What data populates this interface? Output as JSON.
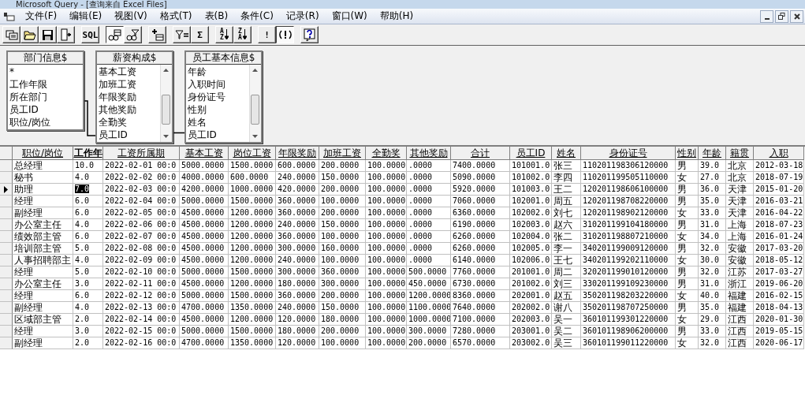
{
  "window": {
    "title": "Microsoft Query - [查询来自 Excel Files]"
  },
  "menu": [
    "文件(F)",
    "编辑(E)",
    "视图(V)",
    "格式(T)",
    "表(B)",
    "条件(C)",
    "记录(R)",
    "窗口(W)",
    "帮助(H)"
  ],
  "toolbar": [
    [
      {
        "kind": "new-query",
        "pressed": false
      },
      {
        "kind": "open",
        "pressed": false
      },
      {
        "kind": "save",
        "pressed": false
      },
      {
        "kind": "return",
        "pressed": false
      }
    ],
    [
      {
        "kind": "text",
        "label": "SQL",
        "pressed": false
      }
    ],
    [
      {
        "kind": "show-tables",
        "pressed": true
      },
      {
        "kind": "show-criteria",
        "pressed": false
      }
    ],
    [
      {
        "kind": "add-tables",
        "pressed": false
      }
    ],
    [
      {
        "kind": "criteria-equals",
        "pressed": false
      },
      {
        "kind": "text",
        "label": "Σ",
        "pressed": false
      }
    ],
    [
      {
        "kind": "sort",
        "letters": [
          "A",
          "Z"
        ],
        "pressed": false
      },
      {
        "kind": "sort",
        "letters": [
          "Z",
          "A"
        ],
        "pressed": false
      }
    ],
    [
      {
        "kind": "text",
        "label": "!",
        "pressed": false
      },
      {
        "kind": "auto-query",
        "pressed": true
      }
    ],
    [
      {
        "kind": "help",
        "pressed": false
      }
    ]
  ],
  "tables": [
    {
      "title": "部门信息$",
      "scrollbar": false,
      "fields": [
        "*",
        "工作年限",
        "所在部门",
        "员工ID",
        "职位/岗位"
      ]
    },
    {
      "title": "薪资构成$",
      "scrollbar": true,
      "fields": [
        "基本工资",
        "加班工资",
        "年限奖励",
        "其他奖励",
        "全勤奖",
        "员工ID"
      ]
    },
    {
      "title": "员工基本信息$",
      "scrollbar": true,
      "fields": [
        "年龄",
        "入职时间",
        "身份证号",
        "性别",
        "姓名",
        "员工ID"
      ]
    }
  ],
  "grid": {
    "columns": [
      {
        "label": "职位/岗位",
        "active": false
      },
      {
        "label": "工作年",
        "active": true
      },
      {
        "label": "工资所属期",
        "active": false
      },
      {
        "label": "基本工资",
        "active": false
      },
      {
        "label": "岗位工资",
        "active": false
      },
      {
        "label": "年限奖励",
        "active": false
      },
      {
        "label": "加班工资",
        "active": false
      },
      {
        "label": "全勤奖",
        "active": false
      },
      {
        "label": "其他奖励",
        "active": false
      },
      {
        "label": "合计",
        "active": false
      },
      {
        "label": "员工ID",
        "active": false
      },
      {
        "label": "姓名",
        "active": false
      },
      {
        "label": "身份证号",
        "active": false
      },
      {
        "label": "性别",
        "active": false
      },
      {
        "label": "年龄",
        "active": false
      },
      {
        "label": "籍贯",
        "active": false
      },
      {
        "label": "入职",
        "active": false
      }
    ],
    "rows": [
      {
        "selected": false,
        "cells": [
          "总经理",
          "10.0",
          "2022-02-01 00:0",
          "5000.0000",
          "1500.0000",
          "600.0000",
          "200.0000",
          "100.0000",
          ".0000",
          "7400.0000",
          "101001.0",
          "张三",
          "110201198306120000",
          "男",
          "39.0",
          "北京",
          "2012-03-18"
        ]
      },
      {
        "selected": false,
        "cells": [
          "秘书",
          "4.0",
          "2022-02-02 00:0",
          "4000.0000",
          "600.0000",
          "240.0000",
          "150.0000",
          "100.0000",
          ".0000",
          "5090.0000",
          "101002.0",
          "李四",
          "110201199505110000",
          "女",
          "27.0",
          "北京",
          "2018-07-19"
        ]
      },
      {
        "selected": true,
        "cells": [
          "助理",
          "7.0",
          "2022-02-03 00:0",
          "4200.0000",
          "1000.0000",
          "420.0000",
          "200.0000",
          "100.0000",
          ".0000",
          "5920.0000",
          "101003.0",
          "王二",
          "120201198606100000",
          "男",
          "36.0",
          "天津",
          "2015-01-20"
        ]
      },
      {
        "selected": false,
        "cells": [
          "经理",
          "6.0",
          "2022-02-04 00:0",
          "5000.0000",
          "1500.0000",
          "360.0000",
          "100.0000",
          "100.0000",
          ".0000",
          "7060.0000",
          "102001.0",
          "周五",
          "120201198708220000",
          "男",
          "35.0",
          "天津",
          "2016-03-21"
        ]
      },
      {
        "selected": false,
        "cells": [
          "副经理",
          "6.0",
          "2022-02-05 00:0",
          "4500.0000",
          "1200.0000",
          "360.0000",
          "200.0000",
          "100.0000",
          ".0000",
          "6360.0000",
          "102002.0",
          "刘七",
          "120201198902120000",
          "女",
          "33.0",
          "天津",
          "2016-04-22"
        ]
      },
      {
        "selected": false,
        "cells": [
          "办公室主任",
          "4.0",
          "2022-02-06 00:0",
          "4500.0000",
          "1200.0000",
          "240.0000",
          "150.0000",
          "100.0000",
          ".0000",
          "6190.0000",
          "102003.0",
          "赵六",
          "310201199104180000",
          "男",
          "31.0",
          "上海",
          "2018-07-23"
        ]
      },
      {
        "selected": false,
        "cells": [
          "绩效部主管",
          "6.0",
          "2022-02-07 00:0",
          "4500.0000",
          "1200.0000",
          "360.0000",
          "100.0000",
          "100.0000",
          ".0000",
          "6260.0000",
          "102004.0",
          "张二",
          "310201198807210000",
          "女",
          "34.0",
          "上海",
          "2016-01-24"
        ]
      },
      {
        "selected": false,
        "cells": [
          "培训部主管",
          "5.0",
          "2022-02-08 00:0",
          "4500.0000",
          "1200.0000",
          "300.0000",
          "160.0000",
          "100.0000",
          ".0000",
          "6260.0000",
          "102005.0",
          "李一",
          "340201199009120000",
          "男",
          "32.0",
          "安徽",
          "2017-03-20"
        ]
      },
      {
        "selected": false,
        "cells": [
          "人事招聘部主",
          "4.0",
          "2022-02-09 00:0",
          "4500.0000",
          "1200.0000",
          "240.0000",
          "100.0000",
          "100.0000",
          ".0000",
          "6140.0000",
          "102006.0",
          "王七",
          "340201199202110000",
          "女",
          "30.0",
          "安徽",
          "2018-05-12"
        ]
      },
      {
        "selected": false,
        "cells": [
          "经理",
          "5.0",
          "2022-02-10 00:0",
          "5000.0000",
          "1500.0000",
          "300.0000",
          "360.0000",
          "100.0000",
          "500.0000",
          "7760.0000",
          "201001.0",
          "周二",
          "320201199010120000",
          "男",
          "32.0",
          "江苏",
          "2017-03-27"
        ]
      },
      {
        "selected": false,
        "cells": [
          "办公室主任",
          "3.0",
          "2022-02-11 00:0",
          "4500.0000",
          "1200.0000",
          "180.0000",
          "300.0000",
          "100.0000",
          "450.0000",
          "6730.0000",
          "201002.0",
          "刘三",
          "330201199109230000",
          "男",
          "31.0",
          "浙江",
          "2019-06-20"
        ]
      },
      {
        "selected": false,
        "cells": [
          "经理",
          "6.0",
          "2022-02-12 00:0",
          "5000.0000",
          "1500.0000",
          "360.0000",
          "200.0000",
          "100.0000",
          "1200.0000",
          "8360.0000",
          "202001.0",
          "赵五",
          "350201198203220000",
          "女",
          "40.0",
          "福建",
          "2016-02-15"
        ]
      },
      {
        "selected": false,
        "cells": [
          "副经理",
          "4.0",
          "2022-02-13 00:0",
          "4700.0000",
          "1350.0000",
          "240.0000",
          "150.0000",
          "100.0000",
          "1100.0000",
          "7640.0000",
          "202002.0",
          "谢八",
          "350201198707250000",
          "男",
          "35.0",
          "福建",
          "2018-04-13"
        ]
      },
      {
        "selected": false,
        "cells": [
          "区域部主管",
          "2.0",
          "2022-02-14 00:0",
          "4500.0000",
          "1200.0000",
          "120.0000",
          "180.0000",
          "100.0000",
          "1000.0000",
          "7100.0000",
          "202003.0",
          "吴一",
          "360101199301220000",
          "女",
          "29.0",
          "江西",
          "2020-01-30"
        ]
      },
      {
        "selected": false,
        "cells": [
          "经理",
          "3.0",
          "2022-02-15 00:0",
          "5000.0000",
          "1500.0000",
          "180.0000",
          "200.0000",
          "100.0000",
          "300.0000",
          "7280.0000",
          "203001.0",
          "吴二",
          "360101198906200000",
          "男",
          "33.0",
          "江西",
          "2019-05-15"
        ]
      },
      {
        "selected": false,
        "cells": [
          "副经理",
          "2.0",
          "2022-02-16 00:0",
          "4700.0000",
          "1350.0000",
          "120.0000",
          "100.0000",
          "100.0000",
          "200.0000",
          "6570.0000",
          "203002.0",
          "吴三",
          "360101199011220000",
          "女",
          "32.0",
          "江西",
          "2020-06-17"
        ]
      }
    ]
  }
}
